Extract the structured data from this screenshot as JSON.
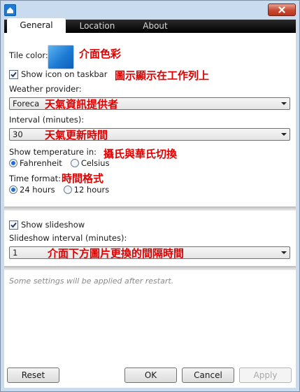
{
  "window": {
    "app_icon": "home-icon",
    "close_icon": "close-x-icon"
  },
  "tabs": [
    {
      "label": "General",
      "active": true
    },
    {
      "label": "Location",
      "active": false
    },
    {
      "label": "About",
      "active": false
    }
  ],
  "general": {
    "tile_color_label": "Tile color:",
    "tile_color_value": "#1c7bd4",
    "tile_color_annotation": "介面色彩",
    "show_icon_label": "Show icon on taskbar",
    "show_icon_checked": true,
    "show_icon_annotation": "圖示顯示在工作列上",
    "weather_provider_label": "Weather provider:",
    "weather_provider_value": "Foreca",
    "weather_provider_annotation": "天氣資訊提供者",
    "interval_label": "Interval (minutes):",
    "interval_value": "30",
    "interval_annotation": "天氣更新時間",
    "temperature_label": "Show temperature in:",
    "temperature_annotation": "攝氏與華氏切換",
    "temperature_options": [
      {
        "label": "Fahrenheit",
        "selected": true
      },
      {
        "label": "Celsius",
        "selected": false
      }
    ],
    "time_format_label": "Time format:",
    "time_format_annotation": "時間格式",
    "time_format_options": [
      {
        "label": "24 hours",
        "selected": true
      },
      {
        "label": "12 hours",
        "selected": false
      }
    ]
  },
  "slideshow": {
    "show_label": "Show slideshow",
    "show_checked": true,
    "interval_label": "Slideshow interval (minutes):",
    "interval_value": "1",
    "interval_annotation": "介面下方圖片更換的間隔時間"
  },
  "note": "Some settings will be applied after restart.",
  "buttons": {
    "reset": "Reset",
    "ok": "OK",
    "cancel": "Cancel",
    "apply": "Apply",
    "apply_enabled": false
  }
}
